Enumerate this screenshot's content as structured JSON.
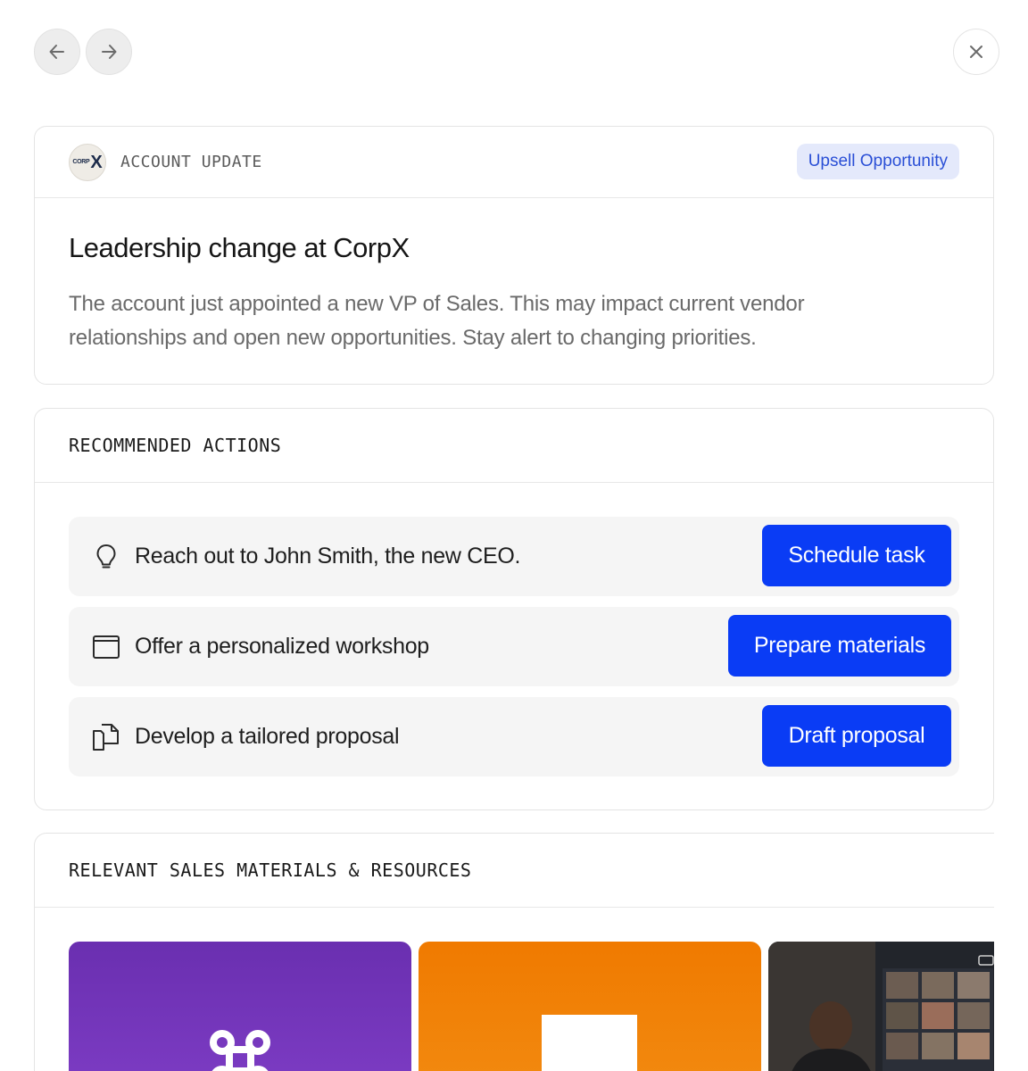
{
  "nav": {
    "back_icon": "arrow-left-icon",
    "forward_icon": "arrow-right-icon",
    "close_icon": "close-icon"
  },
  "update": {
    "logo_text_small": "CORP",
    "logo_text_large": "X",
    "section_label": "ACCOUNT UPDATE",
    "badge": "Upsell Opportunity",
    "title": "Leadership change at CorpX",
    "body": "The account just appointed a new VP of Sales. This may impact current vendor relationships and open new opportunities. Stay alert to changing priorities."
  },
  "actions": {
    "heading": "RECOMMENDED ACTIONS",
    "items": [
      {
        "icon": "lightbulb-icon",
        "text": "Reach out to John Smith, the new CEO.",
        "button": "Schedule task"
      },
      {
        "icon": "window-icon",
        "text": "Offer a personalized workshop",
        "button": "Prepare materials"
      },
      {
        "icon": "documents-icon",
        "text": "Develop a tailored proposal",
        "button": "Draft proposal"
      }
    ]
  },
  "resources": {
    "heading": "RELEVANT SALES MATERIALS & RESOURCES",
    "tiles": [
      {
        "icon": "command-icon"
      },
      {
        "icon": "document-icon"
      },
      {
        "icon": "video-call-photo"
      }
    ]
  },
  "colors": {
    "primary_button": "#0a3cf5",
    "badge_bg": "#e4e9fb",
    "badge_text": "#2a4fd6",
    "tile_purple": "#6a2fb0",
    "tile_orange": "#f07a00"
  }
}
